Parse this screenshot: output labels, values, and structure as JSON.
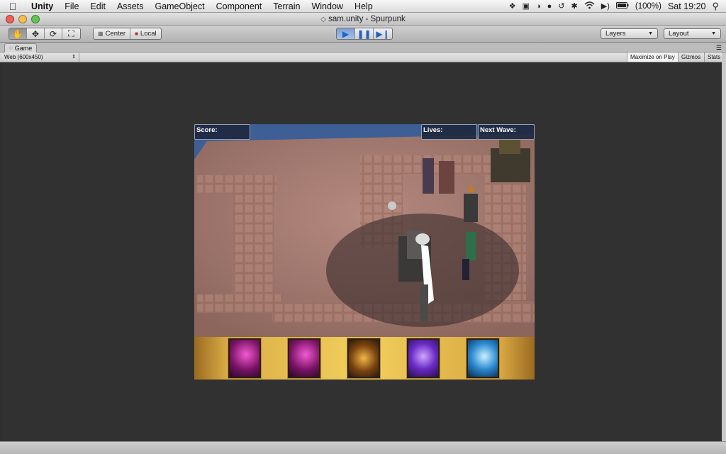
{
  "menubar": {
    "items": [
      "Unity",
      "File",
      "Edit",
      "Assets",
      "GameObject",
      "Component",
      "Terrain",
      "Window",
      "Help"
    ],
    "battery": "(100%)",
    "clock": "Sat 19:20"
  },
  "window": {
    "title": "sam.unity - Spurpunk"
  },
  "toolbar": {
    "pivot_center": "Center",
    "pivot_local": "Local",
    "layers": "Layers",
    "layout": "Layout"
  },
  "game_tab": {
    "label": "Game",
    "resolution": "Web (600x450)",
    "maximize_on_play": "Maximize on Play",
    "gizmos": "Gizmos",
    "stats": "Stats"
  },
  "hud": {
    "score": "Score:",
    "lives": "Lives:",
    "next_wave": "Next Wave:"
  },
  "colors": {
    "menubar": "#e8e8e8",
    "viewport": "#313131",
    "hud_panel": "#1e283e",
    "footer_gold": "#f1cf5c",
    "play_blue": "#1e62c6"
  },
  "cards": [
    {
      "name": "magenta-hooded-figure"
    },
    {
      "name": "magenta-hooded-figure"
    },
    {
      "name": "gold-dragon-emblem"
    },
    {
      "name": "purple-energy-blast"
    },
    {
      "name": "blue-ice-shard"
    }
  ]
}
